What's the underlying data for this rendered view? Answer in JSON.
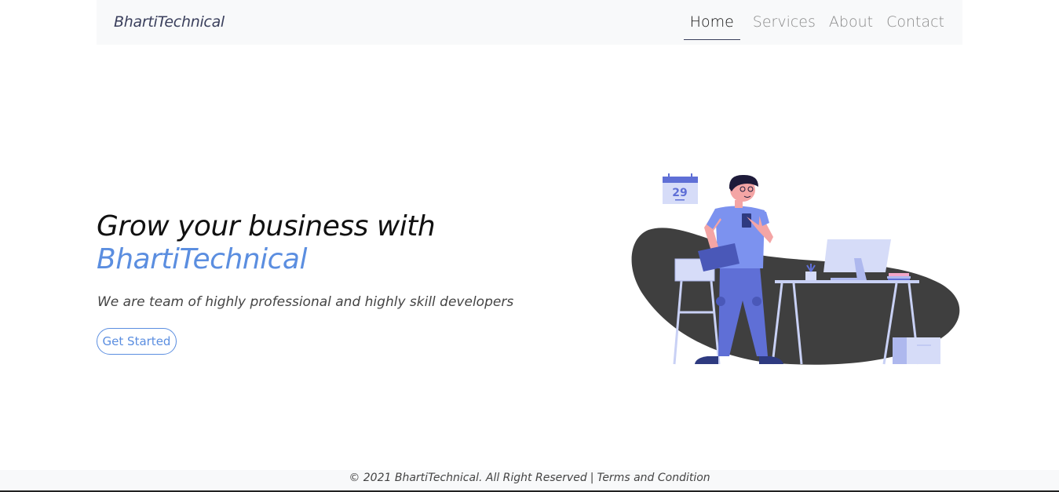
{
  "navbar": {
    "brand": "BhartiTechnical",
    "links": [
      {
        "label": "Home",
        "active": true
      },
      {
        "label": "Services",
        "active": false
      },
      {
        "label": "About",
        "active": false
      },
      {
        "label": "Contact",
        "active": false
      }
    ]
  },
  "hero": {
    "title_line1": "Grow your business with",
    "title_line2": "BhartiTechnical",
    "subtitle": "We are team of highly professional and highly skill developers",
    "cta_label": "Get Started",
    "illustration": {
      "icon": "office-worker-illustration",
      "calendar_day": "29"
    }
  },
  "footer": {
    "copyright": "© 2021 BhartiTechnical. All Right Reserved",
    "separator": "|",
    "terms_label": "Terms and Condition"
  },
  "colors": {
    "accent": "#5b8ee0",
    "navbar_bg": "#f8f9fa",
    "blob": "#3f3f3f"
  }
}
